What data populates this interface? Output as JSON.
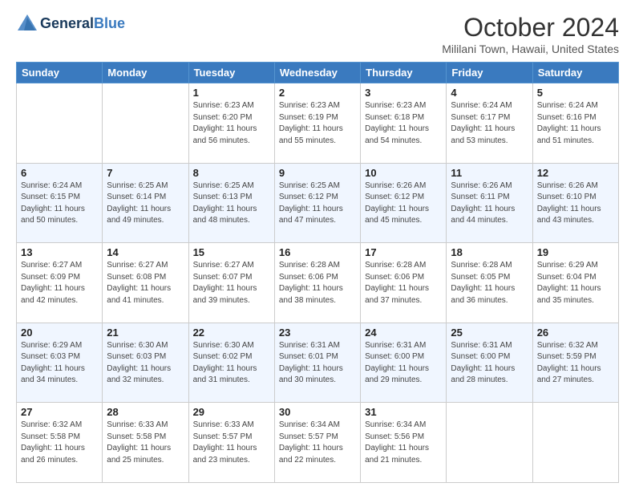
{
  "logo": {
    "line1": "General",
    "line2": "Blue"
  },
  "title": "October 2024",
  "location": "Mililani Town, Hawaii, United States",
  "weekdays": [
    "Sunday",
    "Monday",
    "Tuesday",
    "Wednesday",
    "Thursday",
    "Friday",
    "Saturday"
  ],
  "weeks": [
    [
      {
        "day": "",
        "sunrise": "",
        "sunset": "",
        "daylight": ""
      },
      {
        "day": "",
        "sunrise": "",
        "sunset": "",
        "daylight": ""
      },
      {
        "day": "1",
        "sunrise": "Sunrise: 6:23 AM",
        "sunset": "Sunset: 6:20 PM",
        "daylight": "Daylight: 11 hours and 56 minutes."
      },
      {
        "day": "2",
        "sunrise": "Sunrise: 6:23 AM",
        "sunset": "Sunset: 6:19 PM",
        "daylight": "Daylight: 11 hours and 55 minutes."
      },
      {
        "day": "3",
        "sunrise": "Sunrise: 6:23 AM",
        "sunset": "Sunset: 6:18 PM",
        "daylight": "Daylight: 11 hours and 54 minutes."
      },
      {
        "day": "4",
        "sunrise": "Sunrise: 6:24 AM",
        "sunset": "Sunset: 6:17 PM",
        "daylight": "Daylight: 11 hours and 53 minutes."
      },
      {
        "day": "5",
        "sunrise": "Sunrise: 6:24 AM",
        "sunset": "Sunset: 6:16 PM",
        "daylight": "Daylight: 11 hours and 51 minutes."
      }
    ],
    [
      {
        "day": "6",
        "sunrise": "Sunrise: 6:24 AM",
        "sunset": "Sunset: 6:15 PM",
        "daylight": "Daylight: 11 hours and 50 minutes."
      },
      {
        "day": "7",
        "sunrise": "Sunrise: 6:25 AM",
        "sunset": "Sunset: 6:14 PM",
        "daylight": "Daylight: 11 hours and 49 minutes."
      },
      {
        "day": "8",
        "sunrise": "Sunrise: 6:25 AM",
        "sunset": "Sunset: 6:13 PM",
        "daylight": "Daylight: 11 hours and 48 minutes."
      },
      {
        "day": "9",
        "sunrise": "Sunrise: 6:25 AM",
        "sunset": "Sunset: 6:12 PM",
        "daylight": "Daylight: 11 hours and 47 minutes."
      },
      {
        "day": "10",
        "sunrise": "Sunrise: 6:26 AM",
        "sunset": "Sunset: 6:12 PM",
        "daylight": "Daylight: 11 hours and 45 minutes."
      },
      {
        "day": "11",
        "sunrise": "Sunrise: 6:26 AM",
        "sunset": "Sunset: 6:11 PM",
        "daylight": "Daylight: 11 hours and 44 minutes."
      },
      {
        "day": "12",
        "sunrise": "Sunrise: 6:26 AM",
        "sunset": "Sunset: 6:10 PM",
        "daylight": "Daylight: 11 hours and 43 minutes."
      }
    ],
    [
      {
        "day": "13",
        "sunrise": "Sunrise: 6:27 AM",
        "sunset": "Sunset: 6:09 PM",
        "daylight": "Daylight: 11 hours and 42 minutes."
      },
      {
        "day": "14",
        "sunrise": "Sunrise: 6:27 AM",
        "sunset": "Sunset: 6:08 PM",
        "daylight": "Daylight: 11 hours and 41 minutes."
      },
      {
        "day": "15",
        "sunrise": "Sunrise: 6:27 AM",
        "sunset": "Sunset: 6:07 PM",
        "daylight": "Daylight: 11 hours and 39 minutes."
      },
      {
        "day": "16",
        "sunrise": "Sunrise: 6:28 AM",
        "sunset": "Sunset: 6:06 PM",
        "daylight": "Daylight: 11 hours and 38 minutes."
      },
      {
        "day": "17",
        "sunrise": "Sunrise: 6:28 AM",
        "sunset": "Sunset: 6:06 PM",
        "daylight": "Daylight: 11 hours and 37 minutes."
      },
      {
        "day": "18",
        "sunrise": "Sunrise: 6:28 AM",
        "sunset": "Sunset: 6:05 PM",
        "daylight": "Daylight: 11 hours and 36 minutes."
      },
      {
        "day": "19",
        "sunrise": "Sunrise: 6:29 AM",
        "sunset": "Sunset: 6:04 PM",
        "daylight": "Daylight: 11 hours and 35 minutes."
      }
    ],
    [
      {
        "day": "20",
        "sunrise": "Sunrise: 6:29 AM",
        "sunset": "Sunset: 6:03 PM",
        "daylight": "Daylight: 11 hours and 34 minutes."
      },
      {
        "day": "21",
        "sunrise": "Sunrise: 6:30 AM",
        "sunset": "Sunset: 6:03 PM",
        "daylight": "Daylight: 11 hours and 32 minutes."
      },
      {
        "day": "22",
        "sunrise": "Sunrise: 6:30 AM",
        "sunset": "Sunset: 6:02 PM",
        "daylight": "Daylight: 11 hours and 31 minutes."
      },
      {
        "day": "23",
        "sunrise": "Sunrise: 6:31 AM",
        "sunset": "Sunset: 6:01 PM",
        "daylight": "Daylight: 11 hours and 30 minutes."
      },
      {
        "day": "24",
        "sunrise": "Sunrise: 6:31 AM",
        "sunset": "Sunset: 6:00 PM",
        "daylight": "Daylight: 11 hours and 29 minutes."
      },
      {
        "day": "25",
        "sunrise": "Sunrise: 6:31 AM",
        "sunset": "Sunset: 6:00 PM",
        "daylight": "Daylight: 11 hours and 28 minutes."
      },
      {
        "day": "26",
        "sunrise": "Sunrise: 6:32 AM",
        "sunset": "Sunset: 5:59 PM",
        "daylight": "Daylight: 11 hours and 27 minutes."
      }
    ],
    [
      {
        "day": "27",
        "sunrise": "Sunrise: 6:32 AM",
        "sunset": "Sunset: 5:58 PM",
        "daylight": "Daylight: 11 hours and 26 minutes."
      },
      {
        "day": "28",
        "sunrise": "Sunrise: 6:33 AM",
        "sunset": "Sunset: 5:58 PM",
        "daylight": "Daylight: 11 hours and 25 minutes."
      },
      {
        "day": "29",
        "sunrise": "Sunrise: 6:33 AM",
        "sunset": "Sunset: 5:57 PM",
        "daylight": "Daylight: 11 hours and 23 minutes."
      },
      {
        "day": "30",
        "sunrise": "Sunrise: 6:34 AM",
        "sunset": "Sunset: 5:57 PM",
        "daylight": "Daylight: 11 hours and 22 minutes."
      },
      {
        "day": "31",
        "sunrise": "Sunrise: 6:34 AM",
        "sunset": "Sunset: 5:56 PM",
        "daylight": "Daylight: 11 hours and 21 minutes."
      },
      {
        "day": "",
        "sunrise": "",
        "sunset": "",
        "daylight": ""
      },
      {
        "day": "",
        "sunrise": "",
        "sunset": "",
        "daylight": ""
      }
    ]
  ]
}
